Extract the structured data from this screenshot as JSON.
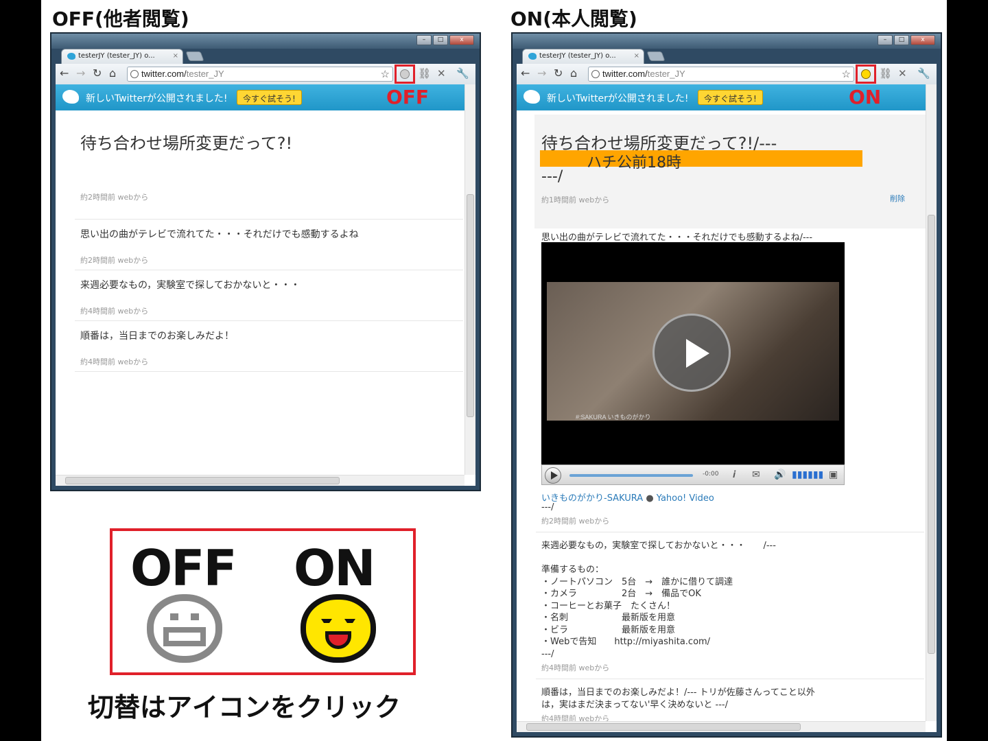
{
  "headings": {
    "off": "OFF(他者閲覧)",
    "on": "ON(本人閲覧)"
  },
  "browser": {
    "tab_title": "testerJY (tester_JY) o...",
    "tab_close": "×",
    "url_host": "twitter.com/",
    "url_path": "tester_JY",
    "banner_message": "新しいTwitterが公開されました!",
    "banner_button": "今すぐ試そう!",
    "window_buttons": [
      "–",
      "□",
      "x"
    ]
  },
  "off_view": {
    "state_label": "OFF",
    "main_tweet": "待ち合わせ場所変更だって?!",
    "main_meta": "約2時間前 webから",
    "tweets": [
      {
        "text": "思い出の曲がテレビで流れてた・・・それだけでも感動するよね",
        "meta": "約2時間前 webから"
      },
      {
        "text": "来週必要なもの，実験室で探しておかないと・・・",
        "meta": "約4時間前 webから"
      },
      {
        "text": "順番は，当日までのお楽しみだよ！",
        "meta": "約4時間前 webから"
      }
    ]
  },
  "on_view": {
    "state_label": "ON",
    "main_tweet": "待ち合わせ場所変更だって?!/---",
    "highlight": "ハチ公前18時",
    "close_marker": "---/",
    "main_meta": "約1時間前 webから",
    "delete_label": "削除",
    "tweet2_text": "思い出の曲がテレビで流れてた・・・それだけでも感動するよね/---",
    "video_caption": "#:SAKURA いきものがかり",
    "video_time": "-0:00",
    "video_link": "いきものがかり-SAKURA",
    "video_source": "Yahoo! Video",
    "tweet2_close": "---/",
    "tweet2_meta": "約2時間前 webから",
    "tweet3_lines": "来週必要なもの，実験室で探しておかないと・・・　　/---\n\n準備するもの：\n・ノートパソコン　5台　→　誰かに借りて調達\n・カメラ　　　　　2台　→　備品でOK\n・コーヒーとお菓子　たくさん！\n・名刺　　　　　　最新版を用意\n・ビラ　　　　　　最新版を用意\n・Webで告知　　http://miyashita.com/\n---/",
    "tweet3_meta": "約4時間前 webから",
    "tweet4_lines": "順番は，当日までのお楽しみだよ！/--- トリが佐藤さんってこと以外\nは，実はまだ決まってない'早く決めないと ---/",
    "tweet4_meta": "約4時間前 webから"
  },
  "legend": {
    "off_label": "OFF",
    "on_label": "ON",
    "off_icon": "neutral-face-icon",
    "on_icon": "smiley-face-icon"
  },
  "caption": "切替はアイコンをクリック",
  "colors": {
    "accent_red": "#e0202a",
    "twitter_blue": "#2aa0d4",
    "highlight_orange": "#ffa500",
    "on_icon": "#ffd800"
  }
}
